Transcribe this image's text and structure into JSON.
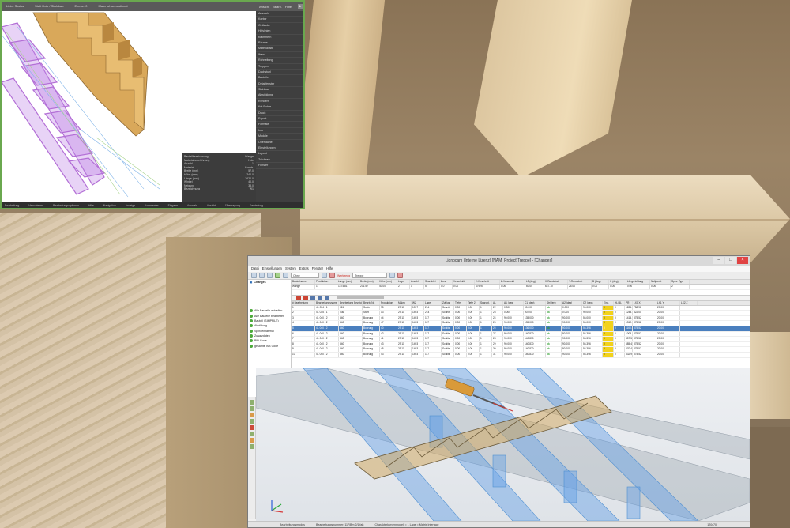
{
  "window_top": {
    "topbar": [
      "Linie: Status",
      "Statt Holz / Stahlbau",
      "Ebene: 0",
      "Material: unbestimmt"
    ],
    "panel_head": [
      "Ansicht",
      "Bearb.",
      "Hilfe"
    ],
    "sidepanel_items": [
      "Auswahl",
      "Kontur",
      "Geländer",
      "Hilfslinien",
      "Klammern",
      "Räume",
      "Materialliste",
      "Wand",
      "Rohrleitung",
      "Treppen",
      "Dachstuhl",
      "Bauteile",
      "Detailfenster",
      "Stahlbau",
      "Abwicklung",
      "Rendern",
      "Kut Rohre",
      "Druck",
      "Export",
      "Formate",
      "Info",
      "Module",
      "Oberfläche",
      "Einstellungen",
      "Layout",
      "Zeichnen",
      "Fenster"
    ],
    "info_box": [
      [
        "Bauteilbezeichnung",
        "Wange"
      ],
      [
        "Materialbezeichnung",
        "Holz"
      ],
      [
        "Anzahl",
        "1"
      ],
      [
        "Material",
        "Konstr."
      ],
      [
        "Breite (mm)",
        "57.0"
      ],
      [
        "Höhe (mm)",
        "240.0"
      ],
      [
        "Länge (mm)",
        "2620.0"
      ],
      [
        "Winkel",
        "40.0"
      ],
      [
        "Neigung",
        "38.0"
      ],
      [
        "Bezeichnung",
        "W1"
      ]
    ],
    "statusbar": [
      "Bearbeitung",
      "Verschieben",
      "Bearbeitungsoptionen",
      "Hilfe",
      "Navigation",
      "Anzeige",
      "Kommentar",
      "Eingabe",
      "Auswahl",
      "Ansicht",
      "Übertragung",
      "Darstellung"
    ]
  },
  "lignocam": {
    "title": "Lignocam (Interne Lizenz) [NAM_Project\\Treppe] - [Changes]",
    "menu": [
      "Datei",
      "Einstellungen",
      "System",
      "Extras",
      "Fenster",
      "Hilfe"
    ],
    "toolbar_selects": [
      "Ohne",
      "Treppe"
    ],
    "toolbar_label": "Werkzeug",
    "tree": {
      "root": "Changes",
      "nodes": [
        "Alle Bauteile aktuellen",
        "Alle Bauteile bearbeiten",
        "Bauteil (SIMPFILE)",
        "Abbildung",
        "Spindelmaterial",
        "Zusatzdaten",
        "BID Code",
        "gesamte ISB Code"
      ]
    },
    "table_head": [
      "Bauteilname",
      "Produktion",
      "Länge (mm)",
      "Breite (mm)",
      "Höhe (mm)",
      "Lage",
      "Anzahl",
      "Sparoblei",
      "Zone",
      "Verschnitt",
      "Y-Verschnitt",
      "Z-Verschnitt",
      "L5 (deg)",
      "X-Randabst.",
      "Y-Randabst.",
      "B (deg)",
      "C (deg)",
      "Längsrichtung",
      "Nullpunkt",
      "Spez. Typ"
    ],
    "top_row": [
      "Wange",
      "1",
      "1474.81",
      "236.52",
      "40.00",
      "2",
      "1",
      "5",
      "0.0",
      "0.00",
      "479.90",
      "0.00",
      "60.00",
      "647.70",
      "25.00",
      "0.00",
      "0.00",
      "0.00",
      "0.00",
      "2"
    ],
    "sub_head": [
      "# Bearbeitung",
      "Bearbeitungsname",
      "Bearbeitung Bezeichnung",
      "Bearb. Nr.",
      "Produktion",
      "Makro",
      "WZ",
      "Lage",
      "Zyklus",
      "Tiefe",
      "Tiefe 2",
      "Sparobl.",
      "AL",
      "A1 (deg)",
      "C1 (deg)",
      "Str/Verb",
      "A2 (deg)",
      "C2 (deg)",
      "Einz.",
      "HL/BL",
      "PR",
      "LX0 X",
      "LX1 Y",
      "LX2 Z"
    ],
    "rows": [
      [
        "1",
        "4 - 034 - 1",
        "024",
        "Sublx",
        "95",
        "29 11",
        "1097",
        "214",
        "Schnitt",
        "0.00",
        "0.00",
        "1",
        "22",
        "0.000",
        "90.000",
        "ok",
        "0.000",
        "90.000",
        "0",
        "0",
        "1286.84",
        "758.98",
        "20.00"
      ],
      [
        "2",
        "4 - 035 - 1",
        "036",
        "Start",
        "13",
        "29 11",
        "1493",
        "214",
        "Schnitt",
        "0.00",
        "0.00",
        "1",
        "23",
        "0.000",
        "90.000",
        "ok",
        "0.000",
        "90.000",
        "0",
        "0",
        "1248.31",
        "822.00",
        "20.00"
      ],
      [
        "3",
        "4 - 040 - 2",
        "340",
        "Bohrung",
        "44",
        "29 11",
        "1493",
        "117",
        "Schlitz",
        "0.00",
        "0.00",
        "1",
        "24",
        "90.000",
        "135.000",
        "ok",
        "90.000",
        "56.000",
        "0",
        "0",
        "1415.81",
        "875.52",
        "20.00"
      ],
      [
        "4",
        "4 - 040 - 2",
        "340",
        "Bohrung",
        "47",
        "29 11",
        "1493",
        "117",
        "Schlitz",
        "0.00",
        "0.00",
        "1",
        "25",
        "90.000",
        "135.000",
        "ok",
        "90.000",
        "56.000",
        "0",
        "0",
        "1312.89",
        "875.52",
        "20.00"
      ],
      [
        "5",
        "4 - 040 - 2",
        "340",
        "Bohrung",
        "40",
        "29 11",
        "1493",
        "117",
        "Schlitz",
        "0.00",
        "0.00",
        "1",
        "26",
        "90.000",
        "136.000",
        "ok",
        "90.000",
        "56.396",
        "0",
        "0",
        "1160.29",
        "875.52",
        "20.00"
      ],
      [
        "6",
        "4 - 040 - 2",
        "340",
        "Bohrung",
        "42",
        "29 11",
        "1493",
        "117",
        "Schlitz",
        "0.00",
        "0.00",
        "1",
        "27",
        "90.000",
        "140.870",
        "ok",
        "90.000",
        "56.396",
        "0",
        "0",
        "1009.32",
        "875.52",
        "20.00"
      ],
      [
        "7",
        "4 - 040 - 2",
        "340",
        "Bohrung",
        "41",
        "29 11",
        "1493",
        "117",
        "Schlitz",
        "0.00",
        "0.00",
        "1",
        "28",
        "90.000",
        "140.870",
        "ok",
        "90.000",
        "56.396",
        "0",
        "0",
        "857.50",
        "875.52",
        "20.00"
      ],
      [
        "8",
        "4 - 040 - 2",
        "340",
        "Bohrung",
        "43",
        "29 11",
        "1493",
        "117",
        "Schlitz",
        "0.00",
        "0.00",
        "1",
        "29",
        "90.000",
        "140.870",
        "ok",
        "90.000",
        "56.396",
        "0",
        "0",
        "685.43",
        "875.52",
        "20.00"
      ],
      [
        "9",
        "4 - 040 - 2",
        "340",
        "Bohrung",
        "45",
        "29 11",
        "1493",
        "117",
        "Schlitz",
        "0.00",
        "0.00",
        "1",
        "30",
        "90.000",
        "140.870",
        "ok",
        "90.000",
        "56.396",
        "0",
        "0",
        "570.42",
        "875.52",
        "20.00"
      ],
      [
        "10",
        "4 - 040 - 2",
        "340",
        "Bohrung",
        "43",
        "29 11",
        "1493",
        "117",
        "Schlitz",
        "0.00",
        "0.00",
        "1",
        "31",
        "90.000",
        "140.870",
        "ok",
        "90.000",
        "56.396",
        "0",
        "0",
        "532.92",
        "875.52",
        "20.00"
      ]
    ],
    "statusbar": [
      "Bearbeitungsmodus",
      "Bearbeitungsnummer: 117/Bm 2/1 fah",
      "Charakterkurvenmodell = 1 Lage = Matrix Interface"
    ],
    "statusbar_right": "120x70"
  }
}
